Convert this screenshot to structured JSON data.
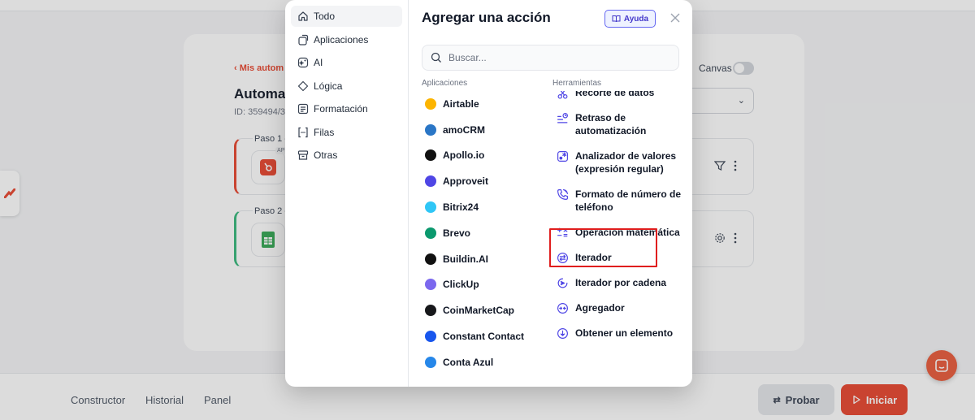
{
  "background": {
    "back_link": "‹  Mis autom",
    "automation_title": "Automat",
    "automation_id": "ID: 359494/3",
    "canvas_label": "Canvas",
    "steps": [
      {
        "label": "Paso 1 -",
        "badge": "APP"
      },
      {
        "label": "Paso 2 -"
      }
    ],
    "bottom_nav": [
      "Constructor",
      "Historial",
      "Panel"
    ],
    "probar_label": "Probar",
    "iniciar_label": "Iniciar"
  },
  "modal": {
    "title": "Agregar una acción",
    "help_label": "Ayuda",
    "search_placeholder": "Buscar...",
    "categories": [
      {
        "label": "Todo",
        "icon": "home-icon",
        "active": true
      },
      {
        "label": "Aplicaciones",
        "icon": "apps-icon"
      },
      {
        "label": "AI",
        "icon": "ai-icon"
      },
      {
        "label": "Lógica",
        "icon": "logic-icon"
      },
      {
        "label": "Formatación",
        "icon": "format-icon"
      },
      {
        "label": "Filas",
        "icon": "brackets-icon"
      },
      {
        "label": "Otras",
        "icon": "archive-icon"
      }
    ],
    "apps_title": "Aplicaciones",
    "apps": [
      {
        "label": "Airtable",
        "color": "#fcb400"
      },
      {
        "label": "amoCRM",
        "color": "#2a76c6"
      },
      {
        "label": "Apollo.io",
        "color": "#111111"
      },
      {
        "label": "Approveit",
        "color": "#4f46e5"
      },
      {
        "label": "Bitrix24",
        "color": "#2fc6f6"
      },
      {
        "label": "Brevo",
        "color": "#0b996e"
      },
      {
        "label": "Buildin.AI",
        "color": "#111111"
      },
      {
        "label": "ClickUp",
        "color": "#7b68ee"
      },
      {
        "label": "CoinMarketCap",
        "color": "#17181b"
      },
      {
        "label": "Constant Contact",
        "color": "#1856ed"
      },
      {
        "label": "Conta Azul",
        "color": "#2687e9"
      }
    ],
    "tools_title": "Herramientas",
    "tools": [
      {
        "label": "Recorte de datos",
        "icon": "scissors-icon"
      },
      {
        "label": "Retraso de automatización",
        "icon": "delay-icon"
      },
      {
        "label": "Analizador de valores (expresión regular)",
        "icon": "regex-icon"
      },
      {
        "label": "Formato de número de teléfono",
        "icon": "phone-icon"
      },
      {
        "label": "Operación matemática",
        "icon": "math-icon"
      },
      {
        "label": "Iterador",
        "icon": "iterator-icon"
      },
      {
        "label": "Iterador por cadena",
        "icon": "string-iterator-icon"
      },
      {
        "label": "Agregador",
        "icon": "aggregator-icon"
      },
      {
        "label": "Obtener un elemento",
        "icon": "get-element-icon"
      }
    ]
  },
  "colors": {
    "accent": "#e8452e",
    "highlight": "#e01e1e",
    "tool_icon": "#4f46e5"
  }
}
